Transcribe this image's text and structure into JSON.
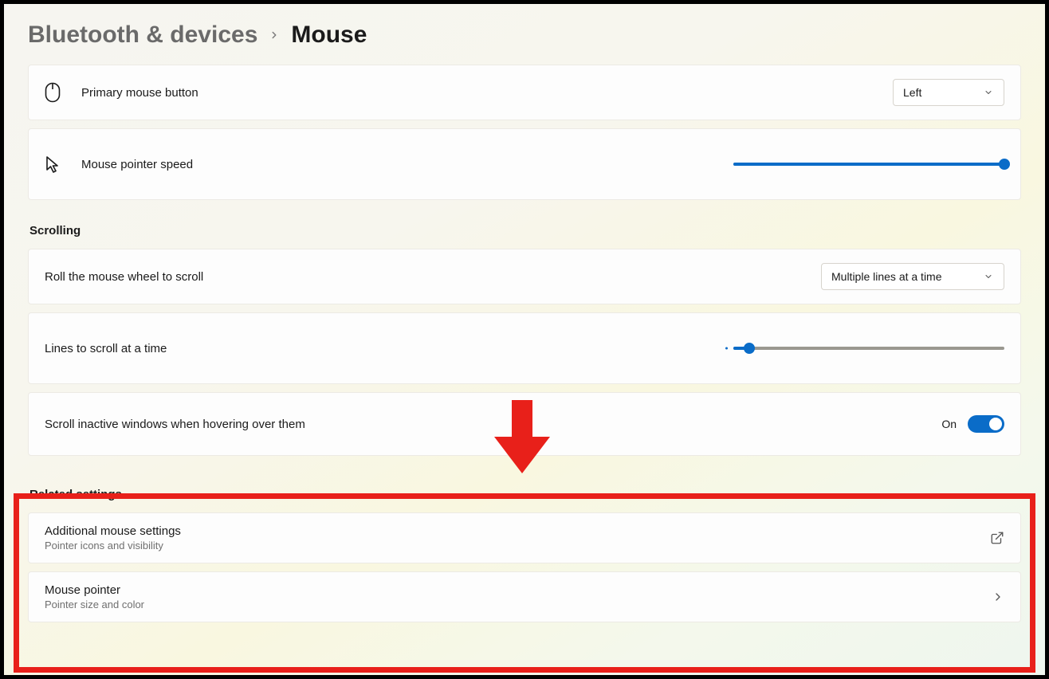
{
  "breadcrumb": {
    "parent": "Bluetooth & devices",
    "current": "Mouse"
  },
  "primary_button": {
    "label": "Primary mouse button",
    "value": "Left"
  },
  "pointer_speed": {
    "label": "Mouse pointer speed",
    "percent": 100
  },
  "sections": {
    "scrolling": "Scrolling",
    "related": "Related settings"
  },
  "scroll_mode": {
    "label": "Roll the mouse wheel to scroll",
    "value": "Multiple lines at a time"
  },
  "lines_to_scroll": {
    "label": "Lines to scroll at a time",
    "percent": 6
  },
  "scroll_inactive": {
    "label": "Scroll inactive windows when hovering over them",
    "state_text": "On",
    "on": true
  },
  "related": {
    "additional": {
      "title": "Additional mouse settings",
      "subtitle": "Pointer icons and visibility"
    },
    "pointer": {
      "title": "Mouse pointer",
      "subtitle": "Pointer size and color"
    }
  }
}
